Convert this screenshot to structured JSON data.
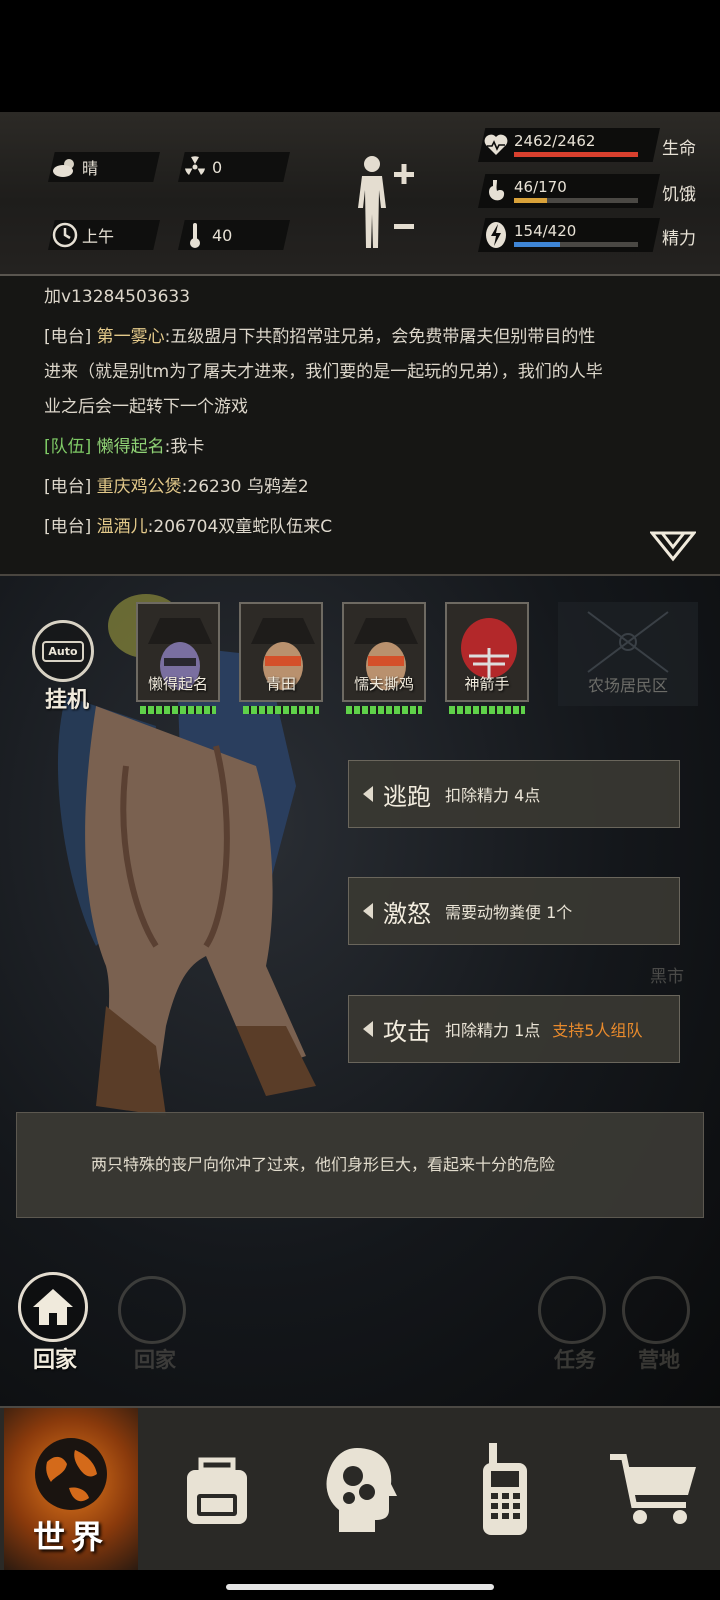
{
  "hud": {
    "weather": {
      "icon": "cloud-sun-icon",
      "value": "晴"
    },
    "radiation": {
      "icon": "radiation-icon",
      "value": "0"
    },
    "time": {
      "icon": "clock-icon",
      "value": "上午"
    },
    "temperature": {
      "icon": "thermometer-icon",
      "value": "40"
    },
    "stats": {
      "hp": {
        "value": "2462/2462",
        "label": "生命",
        "fill": 1.0,
        "color": "#d8402e"
      },
      "hunger": {
        "value": "46/170",
        "label": "饥饿",
        "fill": 0.27,
        "color": "#d9a23a"
      },
      "energy": {
        "value": "154/420",
        "label": "精力",
        "fill": 0.37,
        "color": "#3f86d6"
      }
    }
  },
  "chat": {
    "line1": "加v13284503633",
    "line2": {
      "tag": "[电台]",
      "name": "第一雾心",
      "text": ":五级盟月下共酌招常驻兄弟，会免费带屠夫但别带目的性"
    },
    "line3": "进来（就是别tm为了屠夫才进来，我们要的是一起玩的兄弟），我们的人毕",
    "line4": "业之后会一起转下一个游戏",
    "line5": {
      "tag": "[队伍]",
      "name": "懒得起名",
      "text": ":我卡"
    },
    "line6": {
      "tag": "[电台]",
      "name": "重庆鸡公煲",
      "text": ":26230 乌鸦差2"
    },
    "line7": {
      "tag": "[电台]",
      "name": "温酒儿",
      "text": ":206704双童蛇队伍来C"
    }
  },
  "battle": {
    "auto_label": "挂机",
    "auto_box": "Auto",
    "team": [
      {
        "name": "懒得起名",
        "health": 1.0
      },
      {
        "name": "青田",
        "health": 1.0
      },
      {
        "name": "懦夫撕鸡",
        "health": 1.0
      },
      {
        "name": "神箭手",
        "health": 1.0
      }
    ],
    "locked_slot": "农场居民区",
    "actions": [
      {
        "name": "逃跑",
        "desc": "扣除精力 4点",
        "extra": ""
      },
      {
        "name": "激怒",
        "desc": "需要动物粪便 1个",
        "extra": ""
      },
      {
        "name": "攻击",
        "desc": "扣除精力 1点",
        "extra": "支持5人组队"
      }
    ],
    "message": "两只特殊的丧尸向你冲了过来，他们身形巨大，看起来十分的危险",
    "home_label": "回家",
    "ghost_buttons": [
      "回家",
      "任务",
      "营地"
    ],
    "ghost_side": [
      "黑市"
    ]
  },
  "nav": {
    "world_label": "世界",
    "items": [
      "backpack-icon",
      "skills-head-icon",
      "radio-icon",
      "cart-icon"
    ]
  }
}
